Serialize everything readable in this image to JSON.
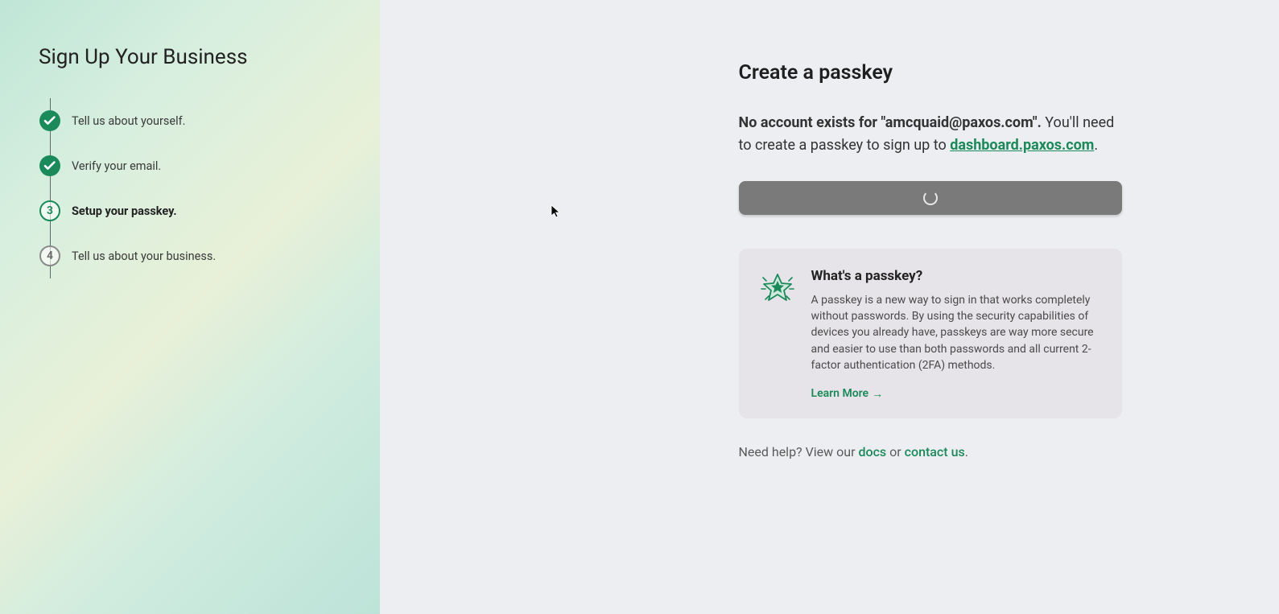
{
  "sidebar": {
    "title": "Sign Up Your Business",
    "steps": [
      {
        "label": "Tell us about yourself.",
        "state": "done"
      },
      {
        "label": "Verify your email.",
        "state": "done"
      },
      {
        "label": "Setup your passkey.",
        "state": "current",
        "number": "3"
      },
      {
        "label": "Tell us about your business.",
        "state": "todo",
        "number": "4"
      }
    ]
  },
  "main": {
    "title": "Create a passkey",
    "intro_bold_prefix": "No account exists for \"",
    "intro_email": "amcquaid@paxos.com",
    "intro_bold_suffix": "\".",
    "intro_rest": " You'll need to create a passkey to sign up to ",
    "intro_link": "dashboard.paxos.com",
    "intro_period": ".",
    "button_state": "loading"
  },
  "info": {
    "title": "What's a passkey?",
    "body": "A passkey is a new way to sign in that works completely without passwords. By using the security capabilities of devices you already have, passkeys are way more secure and easier to use than both passwords and all current 2-factor authentication (2FA) methods.",
    "learn_more": "Learn More"
  },
  "help": {
    "prefix": "Need help? View our ",
    "docs": "docs",
    "or": " or ",
    "contact": "contact us",
    "period": "."
  },
  "colors": {
    "accent": "#1a8a5a",
    "button_bg": "#7a7a7a",
    "card_bg": "#e6e4e8"
  }
}
